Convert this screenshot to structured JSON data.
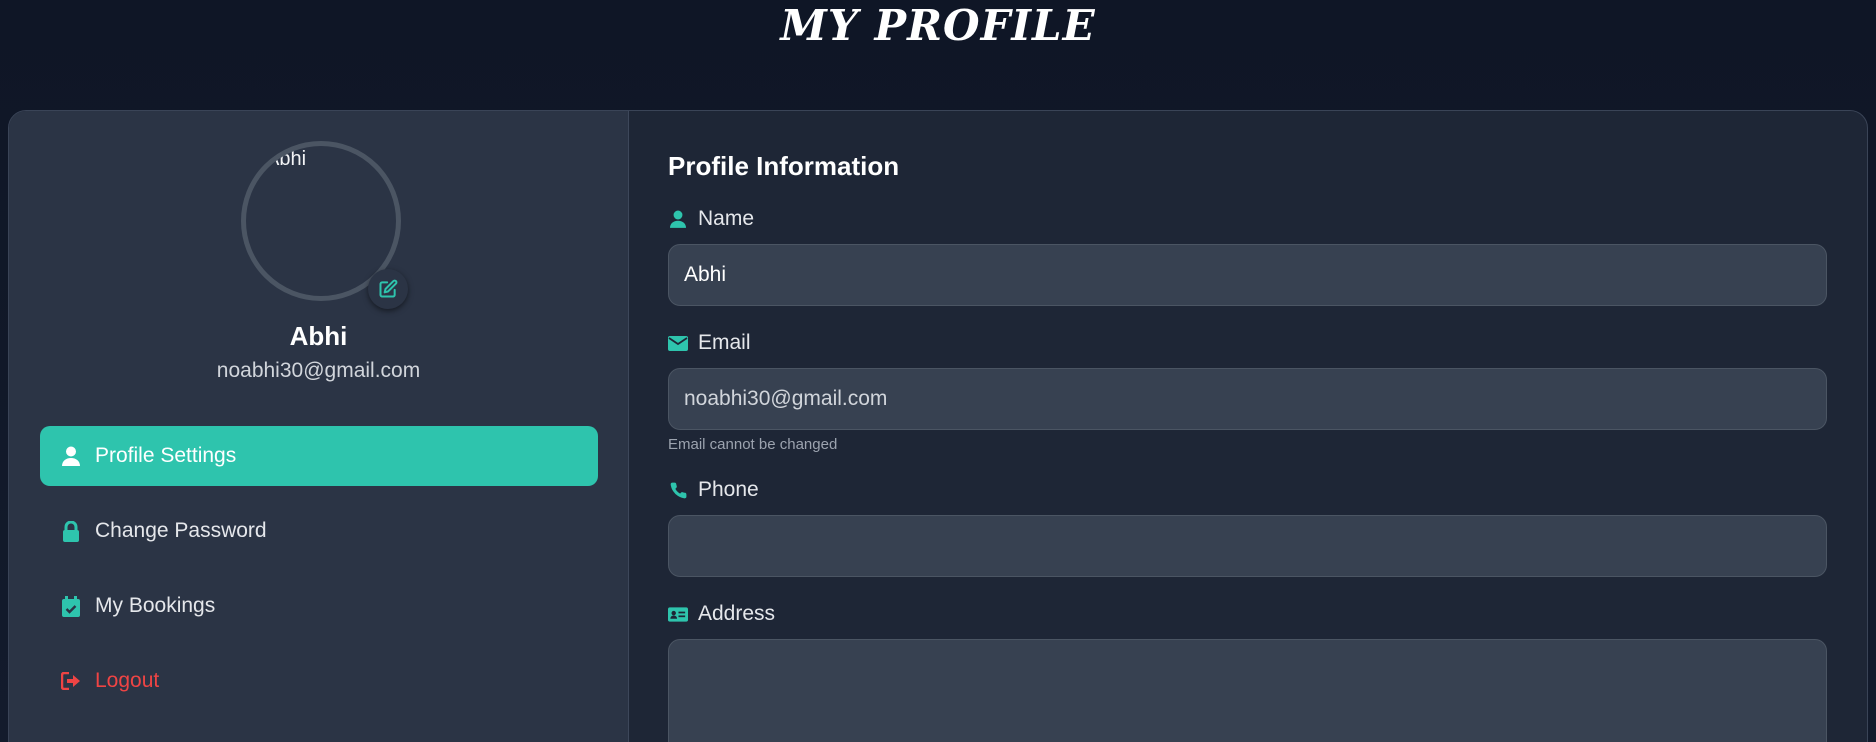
{
  "page": {
    "title": "MY PROFILE"
  },
  "sidebar": {
    "avatar_alt": "Abhi",
    "user_name": "Abhi",
    "user_email": "noabhi30@gmail.com",
    "items": [
      {
        "label": "Profile Settings",
        "icon": "user-icon",
        "active": true
      },
      {
        "label": "Change Password",
        "icon": "lock-icon",
        "active": false
      },
      {
        "label": "My Bookings",
        "icon": "calendar-check-icon",
        "active": false
      },
      {
        "label": "Logout",
        "icon": "sign-out-icon",
        "active": false
      }
    ]
  },
  "form": {
    "section_title": "Profile Information",
    "name": {
      "label": "Name",
      "value": "Abhi",
      "icon": "user-icon"
    },
    "email": {
      "label": "Email",
      "value": "noabhi30@gmail.com",
      "hint": "Email cannot be changed",
      "icon": "envelope-icon"
    },
    "phone": {
      "label": "Phone",
      "value": "",
      "icon": "phone-icon"
    },
    "address": {
      "label": "Address",
      "value": "",
      "icon": "id-card-icon"
    }
  },
  "colors": {
    "accent": "#2ec4ad",
    "danger": "#ef4444",
    "background": "#111827",
    "sidebar": "#2b3445",
    "input": "#374151"
  }
}
